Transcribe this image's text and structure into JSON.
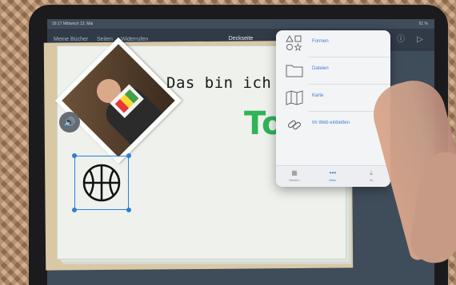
{
  "status": {
    "time": "16:17",
    "date": "Mittwoch 13. Mai",
    "battery": "61 %"
  },
  "nav": {
    "my_books": "Meine Bücher",
    "pages": "Seiten",
    "undo": "Widerrufen",
    "title": "Deckseite"
  },
  "canvas": {
    "heading": "Das bin ich",
    "handwriting": "To"
  },
  "menu": {
    "items": [
      {
        "label": "Formen",
        "icon": "shapes-icon"
      },
      {
        "label": "Dateien",
        "icon": "folder-icon"
      },
      {
        "label": "Karte",
        "icon": "map-icon"
      },
      {
        "label": "Im Web einbetten",
        "icon": "link-icon"
      }
    ],
    "tabs": [
      {
        "label": "Medien"
      },
      {
        "label": "Mehr"
      },
      {
        "label": "Im"
      }
    ]
  },
  "colors": {
    "accent": "#3b7ed4",
    "handwriting": "#2fb457",
    "selection": "#2e7dd6"
  }
}
